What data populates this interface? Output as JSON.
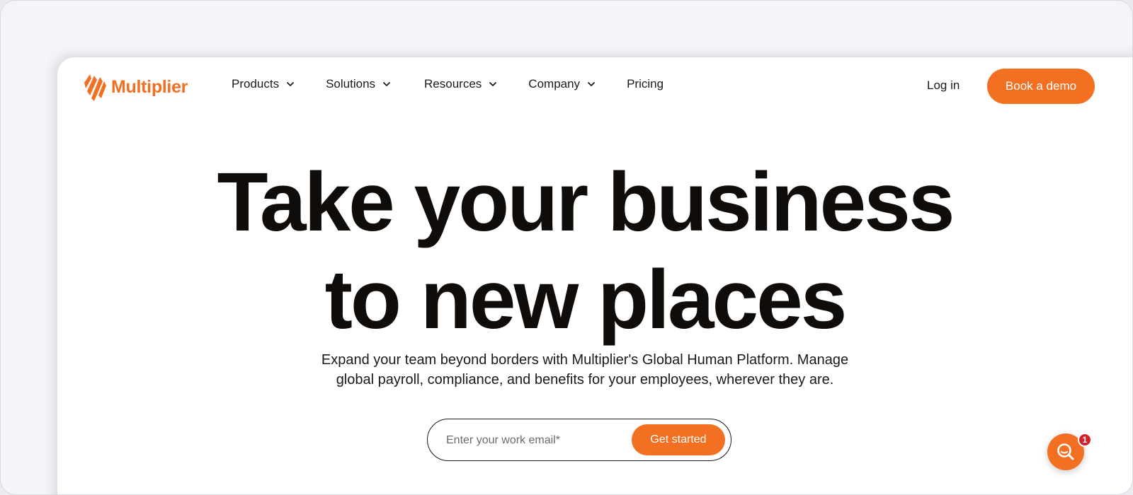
{
  "brand": {
    "name": "Multiplier",
    "accent_color": "#f36f21"
  },
  "nav": {
    "items": [
      {
        "label": "Products",
        "has_dropdown": true
      },
      {
        "label": "Solutions",
        "has_dropdown": true
      },
      {
        "label": "Resources",
        "has_dropdown": true
      },
      {
        "label": "Company",
        "has_dropdown": true
      },
      {
        "label": "Pricing",
        "has_dropdown": false
      }
    ],
    "login_label": "Log in",
    "demo_label": "Book a demo"
  },
  "hero": {
    "title_line1": "Take your business",
    "title_line2": "to new places",
    "subtitle_line1": "Expand your team beyond borders with Multiplier's Global Human Platform. Manage",
    "subtitle_line2": "global payroll, compliance, and benefits for your employees, wherever they are."
  },
  "signup": {
    "placeholder": "Enter your work email*",
    "value": "",
    "button_label": "Get started"
  },
  "chat": {
    "icon": "chat-search-icon",
    "badge_count": "1",
    "badge_color": "#d3202a"
  }
}
